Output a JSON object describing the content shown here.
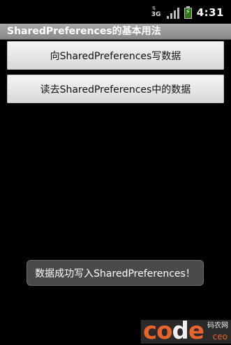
{
  "status_bar": {
    "network_type": "3G",
    "network_arrows": "⇅",
    "battery_icon": "battery-charging-icon",
    "signal_icon": "signal-strength-icon",
    "time": "4:31"
  },
  "app": {
    "title": "SharedPreferences的基本用法"
  },
  "buttons": {
    "write_label": "向SharedPreferences写数据",
    "read_label": "读去SharedPreferences中的数据"
  },
  "toast": {
    "message": "数据成功写入SharedPreferences！"
  },
  "watermark": {
    "logo_part1": "co",
    "logo_part2": "d",
    "logo_part3": "e",
    "subtitle_cn": "码农网",
    "subtitle_en": "ceo"
  },
  "colors": {
    "background": "#000000",
    "title_bar": "#9a9a9a",
    "button": "#e6e6e6",
    "toast": "#4a4a4a",
    "watermark_accent": "#e8642a"
  }
}
